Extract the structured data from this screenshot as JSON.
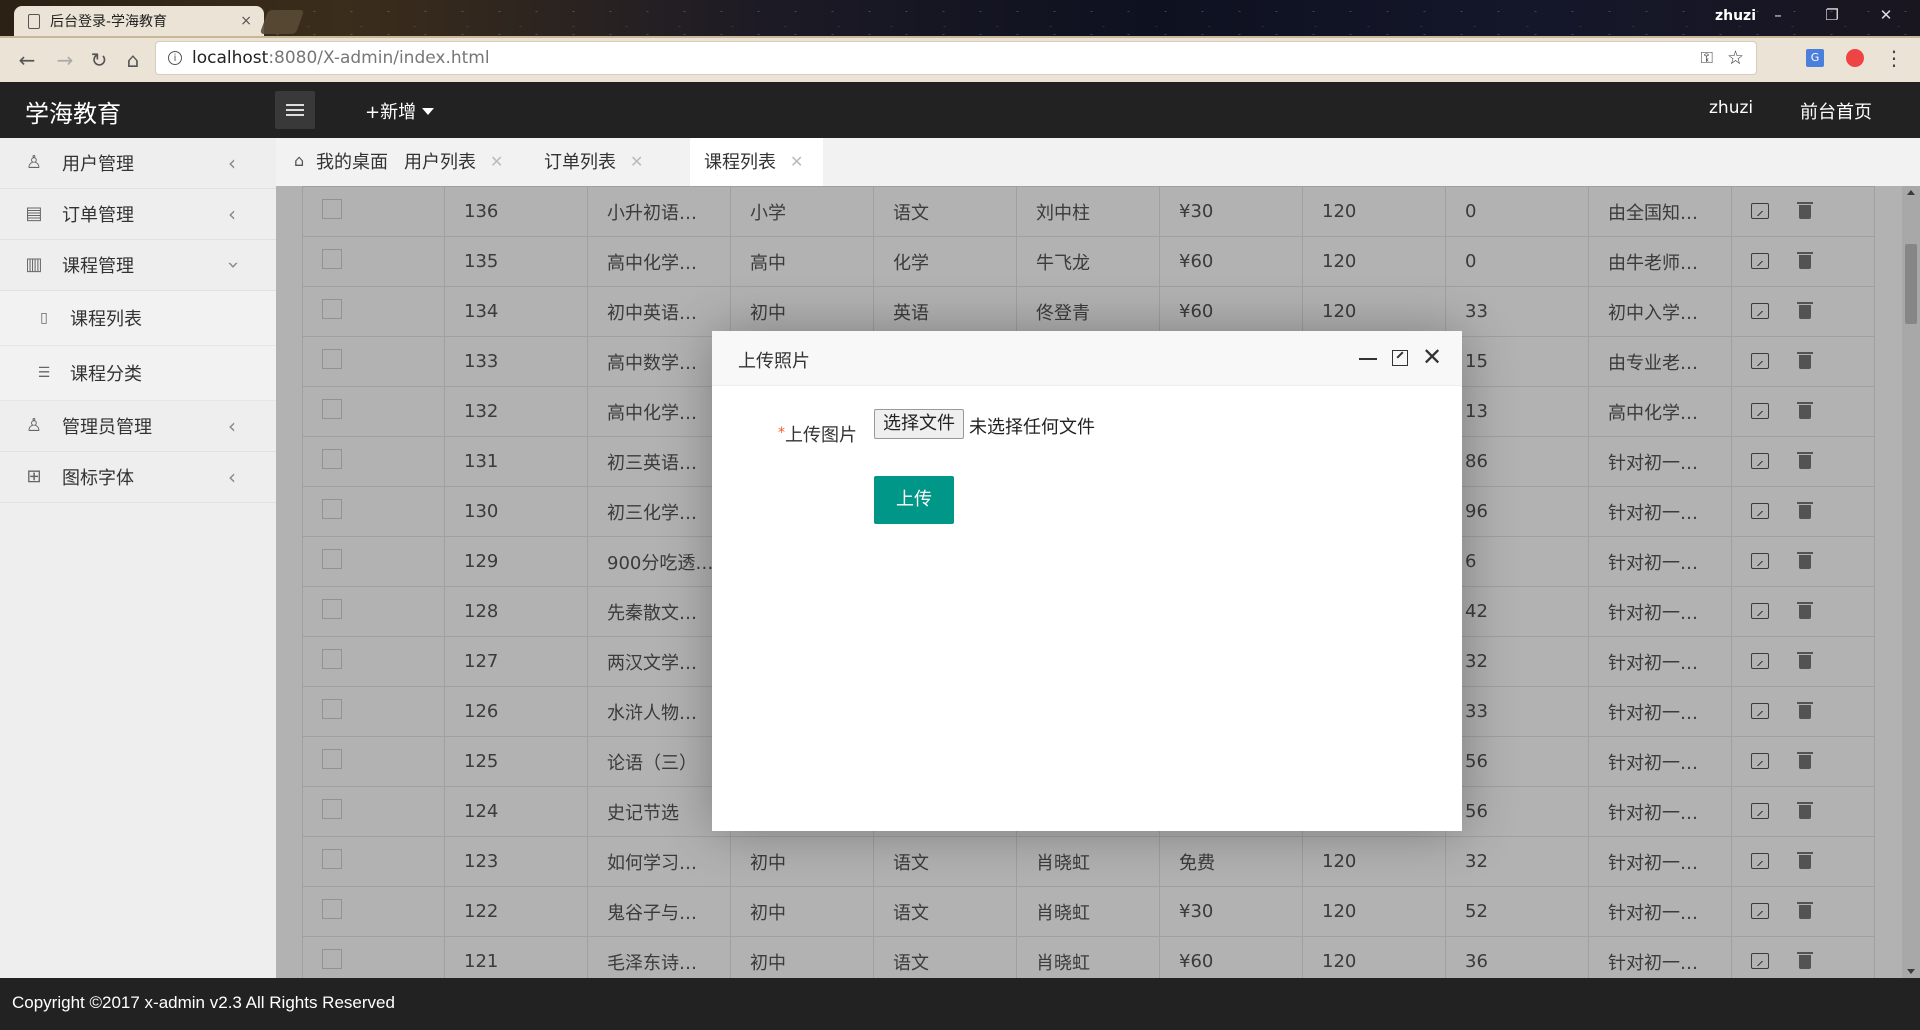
{
  "browser": {
    "tab_title": "后台登录-学海教育",
    "tab_close": "×",
    "window_user": "zhuzi",
    "url_host": "localhost",
    "url_path": ":8080/X-admin/index.html"
  },
  "header": {
    "logo": "学海教育",
    "add_new": "+新增",
    "user": "zhuzi",
    "home_link": "前台首页"
  },
  "sidebar": {
    "items": [
      {
        "label": "用户管理",
        "icon": "user-icon"
      },
      {
        "label": "订单管理",
        "icon": "order-icon"
      },
      {
        "label": "课程管理",
        "icon": "book-icon"
      },
      {
        "label": "管理员管理",
        "icon": "admin-icon"
      },
      {
        "label": "图标字体",
        "icon": "grid-icon"
      }
    ],
    "sub_items": [
      {
        "label": "课程列表",
        "icon": "list-doc-icon"
      },
      {
        "label": "课程分类",
        "icon": "list-lines-icon"
      }
    ]
  },
  "page_tabs": [
    "我的桌面",
    "用户列表",
    "订单列表",
    "课程列表"
  ],
  "table": {
    "rows": [
      [
        "136",
        "小升初语…",
        "小学",
        "语文",
        "刘中柱",
        "¥30",
        "120",
        "0",
        "由全国知…"
      ],
      [
        "135",
        "高中化学…",
        "高中",
        "化学",
        "牛飞龙",
        "¥60",
        "120",
        "0",
        "由牛老师…"
      ],
      [
        "134",
        "初中英语…",
        "初中",
        "英语",
        "佟登青",
        "¥60",
        "120",
        "33",
        "初中入学…"
      ],
      [
        "133",
        "高中数学…",
        "",
        "",
        "",
        "",
        "",
        "15",
        "由专业老…"
      ],
      [
        "132",
        "高中化学…",
        "",
        "",
        "",
        "",
        "",
        "13",
        "高中化学…"
      ],
      [
        "131",
        "初三英语…",
        "",
        "",
        "",
        "",
        "",
        "86",
        "针对初一…"
      ],
      [
        "130",
        "初三化学…",
        "",
        "",
        "",
        "",
        "",
        "96",
        "针对初一…"
      ],
      [
        "129",
        "900分吃透…",
        "",
        "",
        "",
        "",
        "",
        "6",
        "针对初一…"
      ],
      [
        "128",
        "先秦散文…",
        "",
        "",
        "",
        "",
        "",
        "42",
        "针对初一…"
      ],
      [
        "127",
        "两汉文学…",
        "",
        "",
        "",
        "",
        "",
        "32",
        "针对初一…"
      ],
      [
        "126",
        "水浒人物…",
        "",
        "",
        "",
        "",
        "",
        "33",
        "针对初一…"
      ],
      [
        "125",
        "论语（三）",
        "",
        "",
        "",
        "",
        "",
        "56",
        "针对初一…"
      ],
      [
        "124",
        "史记节选",
        "",
        "",
        "",
        "",
        "",
        "56",
        "针对初一…"
      ],
      [
        "123",
        "如何学习…",
        "初中",
        "语文",
        "肖晓虹",
        "免费",
        "120",
        "32",
        "针对初一…"
      ],
      [
        "122",
        "鬼谷子与…",
        "初中",
        "语文",
        "肖晓虹",
        "¥30",
        "120",
        "52",
        "针对初一…"
      ],
      [
        "121",
        "毛泽东诗…",
        "初中",
        "语文",
        "肖晓虹",
        "¥60",
        "120",
        "36",
        "针对初一…"
      ]
    ]
  },
  "modal": {
    "title": "上传照片",
    "required_mark": "*",
    "field_label": "上传图片",
    "file_button": "选择文件",
    "file_status": "未选择任何文件",
    "upload_button": "上传"
  },
  "footer": {
    "copyright": "Copyright ©2017 x-admin v2.3 All Rights Reserved"
  },
  "colors": {
    "header_bg": "#222222",
    "primary_button": "#009688",
    "required_mark": "#ff5722"
  }
}
